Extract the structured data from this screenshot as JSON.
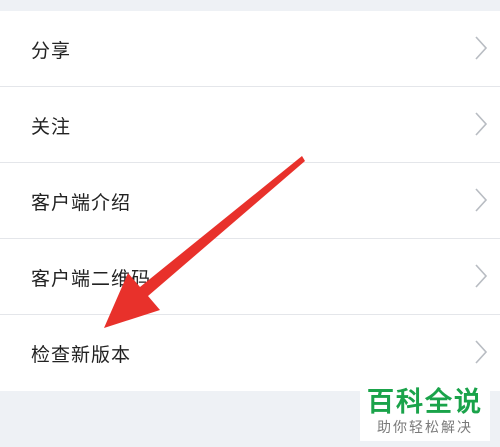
{
  "menu": {
    "items": [
      {
        "label": "分享"
      },
      {
        "label": "关注"
      },
      {
        "label": "客户端介绍"
      },
      {
        "label": "客户端二维码"
      },
      {
        "label": "检查新版本"
      }
    ]
  },
  "watermark": {
    "brand": "百科全说",
    "slogan": "助你轻松解决"
  },
  "colors": {
    "background": "#eef1f5",
    "arrow": "#e8312b",
    "brand_green": "#1aa34a"
  }
}
